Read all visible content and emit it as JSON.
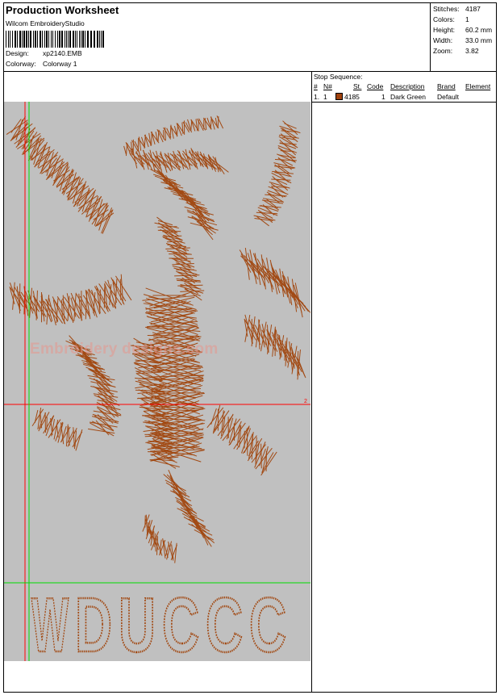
{
  "header": {
    "title": "Production Worksheet",
    "software": "Wilcom EmbroideryStudio",
    "design_label": "Design:",
    "design_value": "xp2140.EMB",
    "colorway_label": "Colorway:",
    "colorway_value": "Colorway 1"
  },
  "stats": [
    {
      "label": "Stitches:",
      "value": "4187"
    },
    {
      "label": "Colors:",
      "value": "1"
    },
    {
      "label": "Height:",
      "value": "60.2 mm"
    },
    {
      "label": "Width:",
      "value": "33.0 mm"
    },
    {
      "label": "Zoom:",
      "value": "3.82"
    }
  ],
  "stop_sequence": {
    "title": "Stop Sequence:",
    "columns": [
      "#",
      "N#",
      "St.",
      "Code",
      "Description",
      "Brand",
      "Element"
    ],
    "rows": [
      {
        "num": "1.",
        "n": "1",
        "st": "4185",
        "code": "1",
        "description": "Dark Green",
        "brand": "Default",
        "element": "",
        "color": "#a0420e"
      }
    ]
  },
  "design": {
    "lettering": "WDUCCC",
    "watermark": "Embroidery designs.com",
    "guide_label": "2",
    "thread_color": "#a24a14",
    "background_color": "#c0c0c0",
    "guide_red": "#ff0000",
    "guide_green": "#00dd00"
  }
}
